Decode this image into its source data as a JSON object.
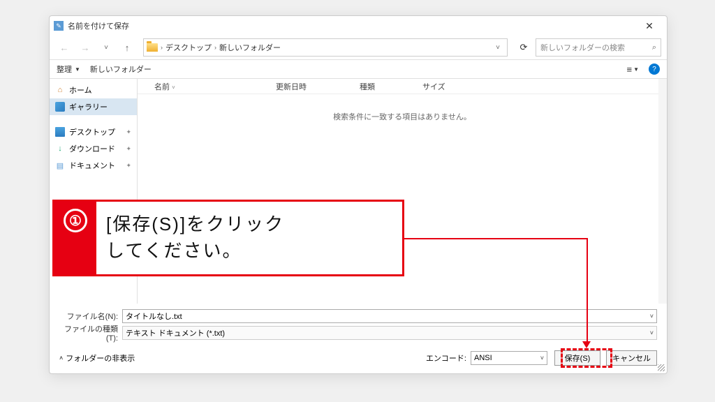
{
  "title": "名前を付けて保存",
  "breadcrumbs": [
    "デスクトップ",
    "新しいフォルダー"
  ],
  "search_placeholder": "新しいフォルダーの検索",
  "toolbar": {
    "organize": "整理",
    "new_folder": "新しいフォルダー"
  },
  "sidebar": {
    "home": "ホーム",
    "gallery": "ギャラリー",
    "desktop": "デスクトップ",
    "downloads": "ダウンロード",
    "documents": "ドキュメント"
  },
  "columns": {
    "name": "名前",
    "date": "更新日時",
    "type": "種類",
    "size": "サイズ"
  },
  "empty_msg": "検索条件に一致する項目はありません。",
  "filename_label": "ファイル名(N):",
  "filename_value": "タイトルなし.txt",
  "filetype_label": "ファイルの種類(T):",
  "filetype_value": "テキスト ドキュメント (*.txt)",
  "hide_folders": "フォルダーの非表示",
  "encoding_label": "エンコード:",
  "encoding_value": "ANSI",
  "save_btn": "保存(S)",
  "cancel_btn": "キャンセル",
  "annotation": {
    "number": "①",
    "line1": "[保存(S)]をクリック",
    "line2": "してください。"
  }
}
